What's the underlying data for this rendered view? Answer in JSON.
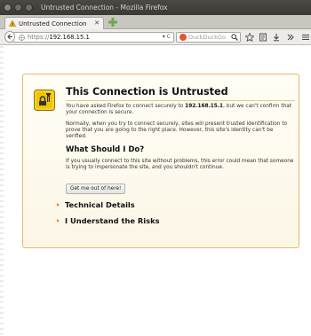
{
  "window": {
    "title": "Untrusted Connection - Mozilla Firefox"
  },
  "tab": {
    "label": "Untrusted Connection"
  },
  "navbar": {
    "url_prefix": "https://",
    "url_host": "192.168.15.1",
    "search_placeholder": "DuckDuckGo"
  },
  "error": {
    "title": "This Connection is Untrusted",
    "p1_before": "You have asked Firefox to connect securely to ",
    "p1_host": "192.168.15.1",
    "p1_after": ", but we can't confirm that your connection is secure.",
    "p2": "Normally, when you try to connect securely, sites will present trusted identification to prove that you are going to the right place. However, this site's identity can't be verified.",
    "what_heading": "What Should I Do?",
    "p3": "If you usually connect to this site without problems, this error could mean that someone is trying to impersonate the site, and you shouldn't continue.",
    "get_out_button": "Get me out of here!",
    "technical_details": "Technical Details",
    "understand_risks": "I Understand the Risks"
  },
  "colors": {
    "accent": "#e8892b",
    "border": "#e7b86a",
    "titlebar": "#3b3a36"
  },
  "icons": [
    "warning-icon",
    "new-tab-icon",
    "back-icon",
    "globe-icon",
    "search-icon",
    "star-icon",
    "bookmarks-icon",
    "download-icon",
    "overflow-icon",
    "menu-icon",
    "untrusted-lock-icon"
  ]
}
